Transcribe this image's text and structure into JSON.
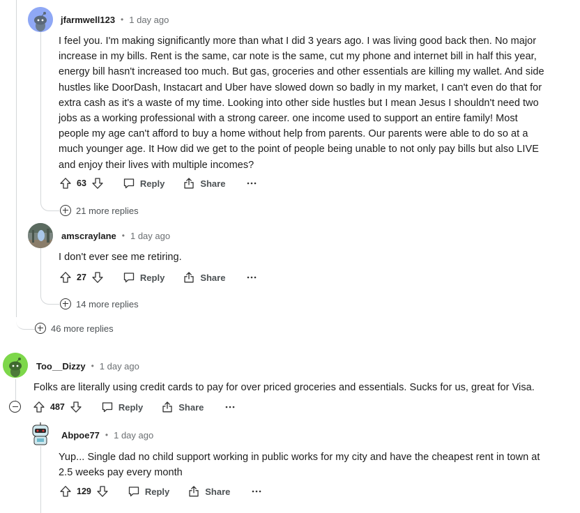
{
  "comments": [
    {
      "author": "jfarmwell123",
      "time": "1 day ago",
      "lines": [
        "I feel you. I'm making significantly more than what I did 3 years ago. I was living good back then. No major",
        "increase in my bills. Rent is the same, car note is the same, cut my phone and internet bill in half this year,",
        "energy bill hasn't increased too much. But gas, groceries and other essentials are killing my wallet. And side",
        "hustles like DoorDash, Instacart and Uber have slowed down so badly in my market, I can't even do that for",
        "extra cash as it's a waste of my time. Looking into other side hustles but I mean Jesus I shouldn't need two",
        "jobs as a working professional with a strong career. one income used to support an entire family! Most",
        "people my age can't afford to buy a home without help from parents. Our parents were able to do so at a",
        "much younger age. It How did we get to the point of people being unable to not only pay bills but also LIVE",
        "and enjoy their lives with multiple incomes?"
      ],
      "score": "63",
      "reply_label": "Reply",
      "share_label": "Share",
      "more_replies": "21 more replies"
    },
    {
      "author": "amscraylane",
      "time": "1 day ago",
      "lines": [
        "I don't ever see me retiring."
      ],
      "score": "27",
      "reply_label": "Reply",
      "share_label": "Share",
      "more_replies": "14 more replies"
    },
    {
      "author": "Too__Dizzy",
      "time": "1 day ago",
      "lines": [
        "Folks are literally using credit cards to pay for over priced groceries and essentials. Sucks for us, great for Visa."
      ],
      "score": "487",
      "reply_label": "Reply",
      "share_label": "Share"
    },
    {
      "author": "Abpoe77",
      "time": "1 day ago",
      "lines": [
        "Yup... Single dad no child support working in public works for my city and have the cheapest rent in town at",
        "2.5 weeks pay every month"
      ],
      "score": "129",
      "reply_label": "Reply",
      "share_label": "Share"
    }
  ],
  "outer_more_replies": "46 more replies",
  "separator": "•",
  "icons": {
    "upvote": "arrow-up-icon",
    "downvote": "arrow-down-icon",
    "reply": "speech-bubble-icon",
    "share": "share-icon",
    "more": "ellipsis-icon",
    "expand": "plus-circle-icon",
    "collapse": "minus-circle-icon"
  },
  "colors": {
    "avatar_blue": "#8fa8f5",
    "avatar_green": "#7dd74a",
    "thread_line": "#d4d7d9",
    "meta_text": "#6b6f72"
  }
}
